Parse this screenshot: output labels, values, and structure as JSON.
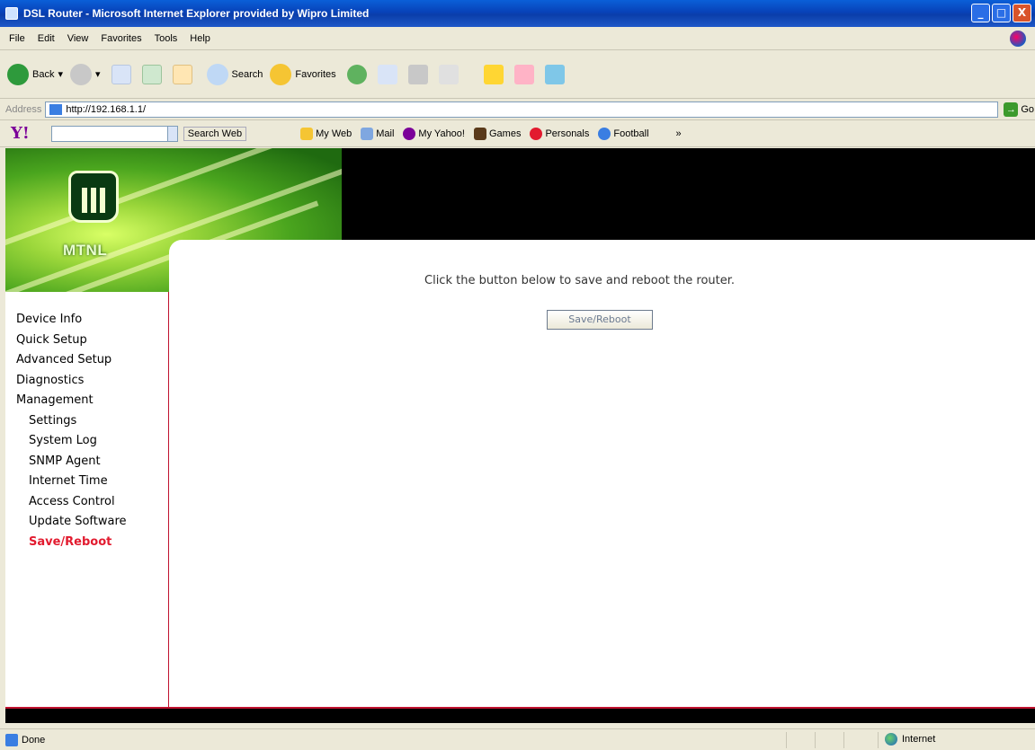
{
  "window": {
    "title": "DSL Router - Microsoft Internet Explorer provided by Wipro Limited",
    "buttons": {
      "minimize": "_",
      "maximize": "□",
      "close": "X"
    }
  },
  "menu": {
    "items": [
      "File",
      "Edit",
      "View",
      "Favorites",
      "Tools",
      "Help"
    ]
  },
  "toolbar": {
    "back_label": "Back",
    "search_label": "Search",
    "favorites_label": "Favorites"
  },
  "address": {
    "label": "Address",
    "url": "http://192.168.1.1/",
    "go_label": "Go"
  },
  "yahoo": {
    "logo": "Y!",
    "search_web_label": "Search Web",
    "items": [
      "My Web",
      "Mail",
      "My Yahoo!",
      "Games",
      "Personals",
      "Football"
    ]
  },
  "banner": {
    "brand": "MTNL"
  },
  "sidebar": {
    "items": [
      {
        "label": "Device Info"
      },
      {
        "label": "Quick Setup"
      },
      {
        "label": "Advanced Setup"
      },
      {
        "label": "Diagnostics"
      },
      {
        "label": "Management"
      },
      {
        "label": "Settings"
      },
      {
        "label": "System Log"
      },
      {
        "label": "SNMP Agent"
      },
      {
        "label": "Internet Time"
      },
      {
        "label": "Access Control"
      },
      {
        "label": "Update Software"
      },
      {
        "label": "Save/Reboot"
      }
    ]
  },
  "main": {
    "message": "Click the button below to save and reboot the router.",
    "button_label": "Save/Reboot"
  },
  "status": {
    "text": "Done",
    "zone": "Internet"
  },
  "colors": {
    "accent_red": "#e21b2f",
    "banner_green": "#4aa51e",
    "titlebar_blue": "#0842b8"
  }
}
